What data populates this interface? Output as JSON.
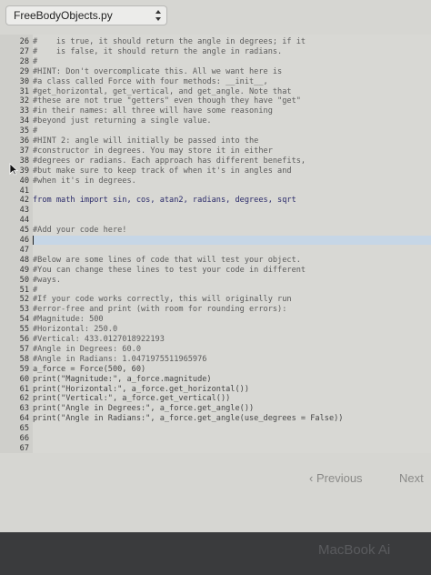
{
  "file_select": {
    "value": "FreeBodyObjects.py",
    "icon": "updown-arrows-icon"
  },
  "code": {
    "lines": [
      {
        "n": "26",
        "t": "#    is true, it should return the angle in degrees; if it",
        "k": "comment"
      },
      {
        "n": "27",
        "t": "#    is false, it should return the angle in radians.",
        "k": "comment"
      },
      {
        "n": "28",
        "t": "#",
        "k": "comment"
      },
      {
        "n": "29",
        "t": "#HINT: Don't overcomplicate this. All we want here is",
        "k": "comment"
      },
      {
        "n": "30",
        "t": "#a class called Force with four methods: __init__,",
        "k": "comment"
      },
      {
        "n": "31",
        "t": "#get_horizontal, get_vertical, and get_angle. Note that",
        "k": "comment"
      },
      {
        "n": "32",
        "t": "#these are not true \"getters\" even though they have \"get\"",
        "k": "comment"
      },
      {
        "n": "33",
        "t": "#in their names: all three will have some reasoning",
        "k": "comment"
      },
      {
        "n": "34",
        "t": "#beyond just returning a single value.",
        "k": "comment"
      },
      {
        "n": "35",
        "t": "#",
        "k": "comment"
      },
      {
        "n": "36",
        "t": "#HINT 2: angle will initially be passed into the",
        "k": "comment"
      },
      {
        "n": "37",
        "t": "#constructor in degrees. You may store it in either",
        "k": "comment"
      },
      {
        "n": "38",
        "t": "#degrees or radians. Each approach has different benefits,",
        "k": "comment"
      },
      {
        "n": "39",
        "t": "#but make sure to keep track of when it's in angles and",
        "k": "comment"
      },
      {
        "n": "40",
        "t": "#when it's in degrees.",
        "k": "comment"
      },
      {
        "n": "41",
        "t": "",
        "k": "code"
      },
      {
        "n": "42",
        "t": "from math import sin, cos, atan2, radians, degrees, sqrt",
        "k": "keyword"
      },
      {
        "n": "43",
        "t": "",
        "k": "code"
      },
      {
        "n": "44",
        "t": "",
        "k": "code"
      },
      {
        "n": "45",
        "t": "#Add your code here!",
        "k": "comment"
      },
      {
        "n": "46",
        "t": "",
        "k": "code"
      },
      {
        "n": "47",
        "t": "",
        "k": "code"
      },
      {
        "n": "48",
        "t": "#Below are some lines of code that will test your object.",
        "k": "comment"
      },
      {
        "n": "49",
        "t": "#You can change these lines to test your code in different",
        "k": "comment"
      },
      {
        "n": "50",
        "t": "#ways.",
        "k": "comment"
      },
      {
        "n": "51",
        "t": "#",
        "k": "comment"
      },
      {
        "n": "52",
        "t": "#If your code works correctly, this will originally run",
        "k": "comment"
      },
      {
        "n": "53",
        "t": "#error-free and print (with room for rounding errors):",
        "k": "comment"
      },
      {
        "n": "54",
        "t": "#Magnitude: 500",
        "k": "comment"
      },
      {
        "n": "55",
        "t": "#Horizontal: 250.0",
        "k": "comment"
      },
      {
        "n": "56",
        "t": "#Vertical: 433.0127018922193",
        "k": "comment"
      },
      {
        "n": "57",
        "t": "#Angle in Degrees: 60.0",
        "k": "comment"
      },
      {
        "n": "58",
        "t": "#Angle in Radians: 1.0471975511965976",
        "k": "comment"
      },
      {
        "n": "59",
        "t": "a_force = Force(500, 60)",
        "k": "code"
      },
      {
        "n": "60",
        "t": "print(\"Magnitude:\", a_force.magnitude)",
        "k": "code"
      },
      {
        "n": "61",
        "t": "print(\"Horizontal:\", a_force.get_horizontal())",
        "k": "code"
      },
      {
        "n": "62",
        "t": "print(\"Vertical:\", a_force.get_vertical())",
        "k": "code"
      },
      {
        "n": "63",
        "t": "print(\"Angle in Degrees:\", a_force.get_angle())",
        "k": "code"
      },
      {
        "n": "64",
        "t": "print(\"Angle in Radians:\", a_force.get_angle(use_degrees = False))",
        "k": "code"
      },
      {
        "n": "65",
        "t": "",
        "k": "code"
      },
      {
        "n": "66",
        "t": "",
        "k": "code"
      },
      {
        "n": "67",
        "t": "",
        "k": "code"
      }
    ]
  },
  "pager": {
    "previous": "Previous",
    "next": "Next",
    "previous_icon": "chevron-left-icon"
  },
  "device_label": "MacBook Ai",
  "colors": {
    "editor_bg": "#d8d8d4",
    "highlight_line": "#c6d6e6",
    "bezel": "#3a3b3d"
  }
}
